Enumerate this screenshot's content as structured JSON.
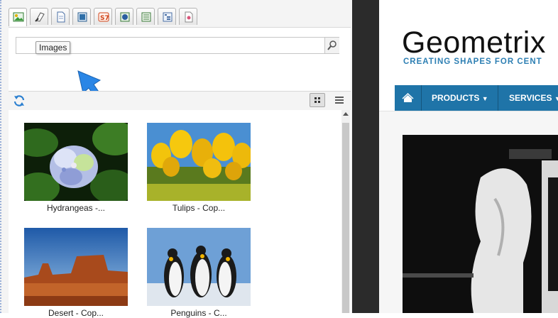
{
  "tabs": [
    {
      "icon": "images-icon",
      "active": true
    },
    {
      "icon": "pages-icon"
    },
    {
      "icon": "documents-icon"
    },
    {
      "icon": "movies-icon"
    },
    {
      "icon": "s7-icon"
    },
    {
      "icon": "flash-icon"
    },
    {
      "icon": "paragraphs-icon"
    },
    {
      "icon": "site-tree-icon"
    },
    {
      "icon": "products-icon"
    }
  ],
  "search": {
    "value": "",
    "tooltip": "Images"
  },
  "view": {
    "mode": "grid"
  },
  "assets": [
    {
      "caption": "Hydrangeas -...",
      "image": "hydrangeas"
    },
    {
      "caption": "Tulips - Cop...",
      "image": "tulips"
    },
    {
      "caption": "Desert - Cop...",
      "image": "desert"
    },
    {
      "caption": "Penguins - C...",
      "image": "penguins"
    }
  ],
  "preview": {
    "logo_text": "Geometrix",
    "tagline": "CREATING SHAPES FOR CENT",
    "nav": {
      "products": "PRODUCTS",
      "services": "SERVICES"
    }
  },
  "colors": {
    "nav_blue": "#1f74a8",
    "tagline_blue": "#2d7fb3",
    "arrow_blue": "#2a86e6"
  }
}
